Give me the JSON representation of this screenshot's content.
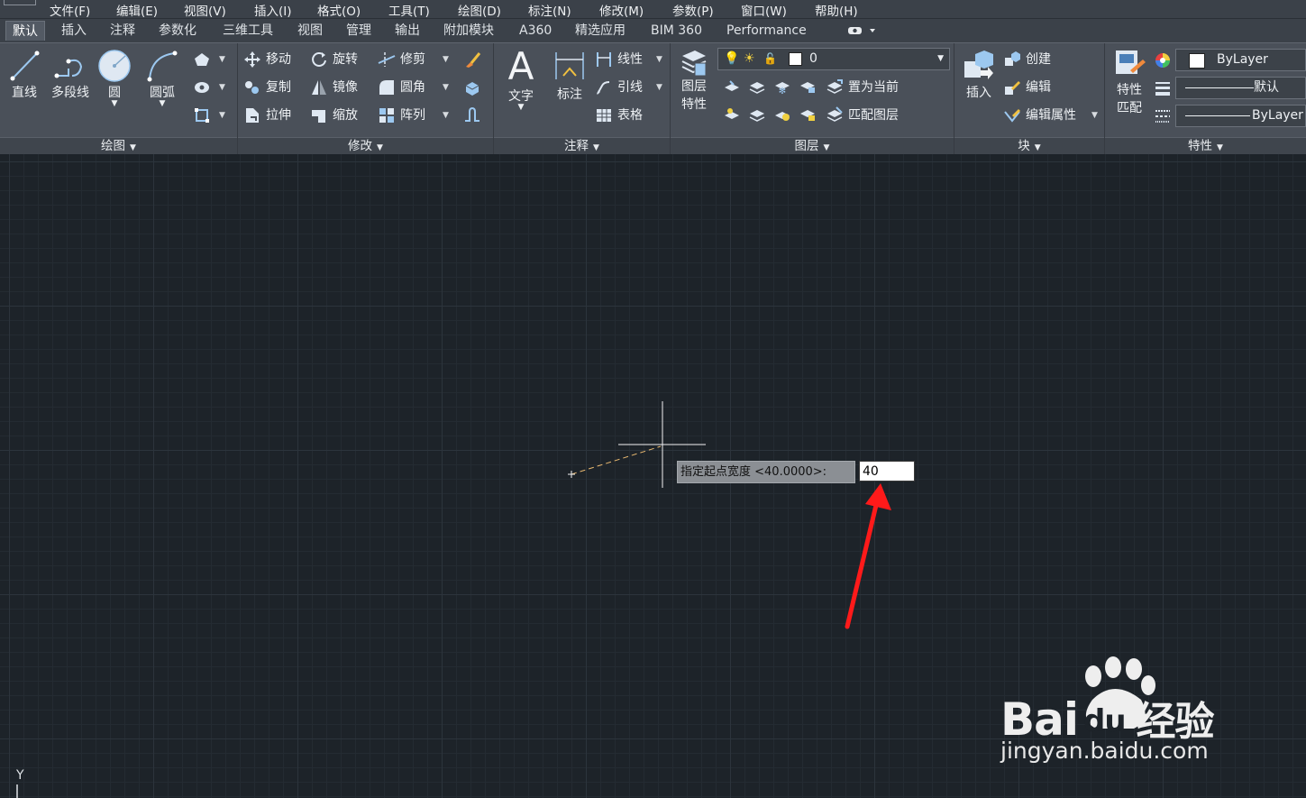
{
  "menu": [
    "文件(F)",
    "编辑(E)",
    "视图(V)",
    "插入(I)",
    "格式(O)",
    "工具(T)",
    "绘图(D)",
    "标注(N)",
    "修改(M)",
    "参数(P)",
    "窗口(W)",
    "帮助(H)"
  ],
  "tabs": [
    "默认",
    "插入",
    "注释",
    "参数化",
    "三维工具",
    "视图",
    "管理",
    "输出",
    "附加模块",
    "A360",
    "精选应用",
    "BIM 360",
    "Performance"
  ],
  "panels": {
    "draw": {
      "title": "绘图",
      "line": "直线",
      "polyline": "多段线",
      "circle": "圆",
      "arc": "圆弧"
    },
    "modify": {
      "title": "修改",
      "move": "移动",
      "rotate": "旋转",
      "trim": "修剪",
      "copy": "复制",
      "mirror": "镜像",
      "fillet": "圆角",
      "stretch": "拉伸",
      "scale": "缩放",
      "array": "阵列"
    },
    "annotation": {
      "title": "注释",
      "text": "文字",
      "dimension": "标注",
      "linear": "线性",
      "leader": "引线",
      "table": "表格"
    },
    "layers": {
      "title": "图层",
      "layer_properties": "图层\n特性",
      "layer_properties_line1": "图层",
      "layer_properties_line2": "特性",
      "current_layer": "0",
      "set_current": "置为当前",
      "match_layer": "匹配图层"
    },
    "block": {
      "title": "块",
      "insert": "插入",
      "create": "创建",
      "edit": "编辑",
      "edit_attributes": "编辑属性"
    },
    "properties": {
      "title": "特性",
      "match_line1": "特性",
      "match_line2": "匹配",
      "color": "ByLayer",
      "linetype": "默认",
      "lineweight": "ByLayer"
    }
  },
  "canvas": {
    "prompt": "指定起点宽度 <40.0000>:",
    "input_value": "40",
    "ucs_label": "Y"
  },
  "watermark": {
    "brand_left": "Bai",
    "brand_mid": "du",
    "brand_right": "经验",
    "url": "jingyan.baidu.com"
  },
  "colors": {
    "ribbon": "#4a5059",
    "canvas": "#1d2329",
    "arrow": "#ff1a1a",
    "accent": "#4aa3ff"
  }
}
